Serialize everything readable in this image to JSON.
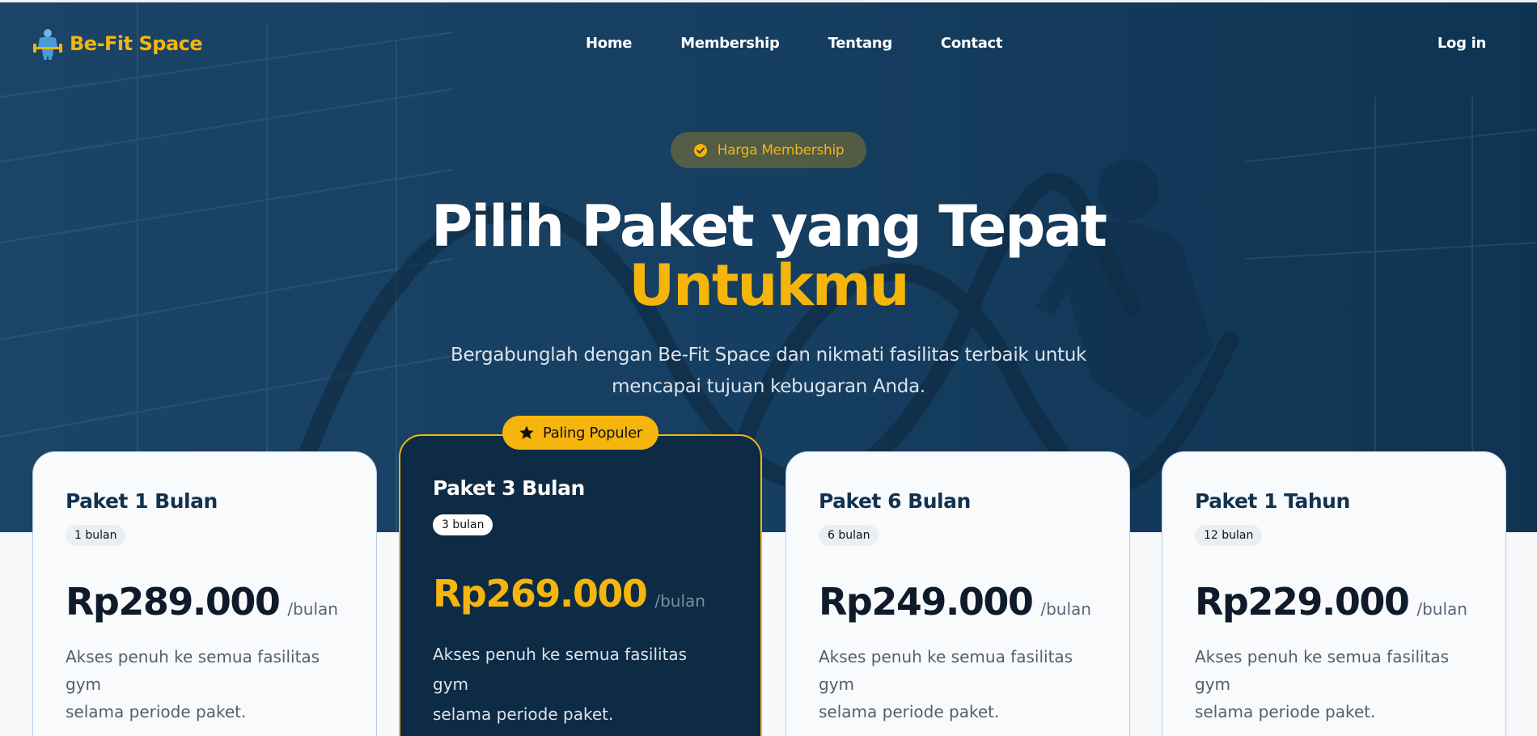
{
  "brand": {
    "name": "Be-Fit Space"
  },
  "nav": {
    "items": [
      {
        "label": "Home"
      },
      {
        "label": "Membership"
      },
      {
        "label": "Tentang"
      },
      {
        "label": "Contact"
      }
    ],
    "login_label": "Log in"
  },
  "hero": {
    "badge": "Harga Membership",
    "title_line1": "Pilih Paket yang Tepat",
    "title_line2": "Untukmu",
    "subtitle_line1": "Bergabunglah dengan Be-Fit Space dan nikmati fasilitas terbaik untuk",
    "subtitle_line2": "mencapai tujuan kebugaran Anda."
  },
  "popular_label": "Paling Populer",
  "plans": [
    {
      "title": "Paket 1 Bulan",
      "duration": "1 bulan",
      "price": "Rp289.000",
      "per": "/bulan",
      "desc_line1": "Akses penuh ke semua fasilitas gym",
      "desc_line2": "selama periode paket."
    },
    {
      "title": "Paket 3 Bulan",
      "duration": "3 bulan",
      "price": "Rp269.000",
      "per": "/bulan",
      "desc_line1": "Akses penuh ke semua fasilitas gym",
      "desc_line2": "selama periode paket."
    },
    {
      "title": "Paket 6 Bulan",
      "duration": "6 bulan",
      "price": "Rp249.000",
      "per": "/bulan",
      "desc_line1": "Akses penuh ke semua fasilitas gym",
      "desc_line2": "selama periode paket."
    },
    {
      "title": "Paket 1 Tahun",
      "duration": "12 bulan",
      "price": "Rp229.000",
      "per": "/bulan",
      "desc_line1": "Akses penuh ke semua fasilitas gym",
      "desc_line2": "selama periode paket."
    }
  ],
  "colors": {
    "navy": "#14395a",
    "accent": "#f5b50c",
    "card_featured": "#0e2b45"
  },
  "icons": {
    "logo": "bodybuilder-logo-icon",
    "badge": "check-circle-icon",
    "popular": "star-icon"
  }
}
